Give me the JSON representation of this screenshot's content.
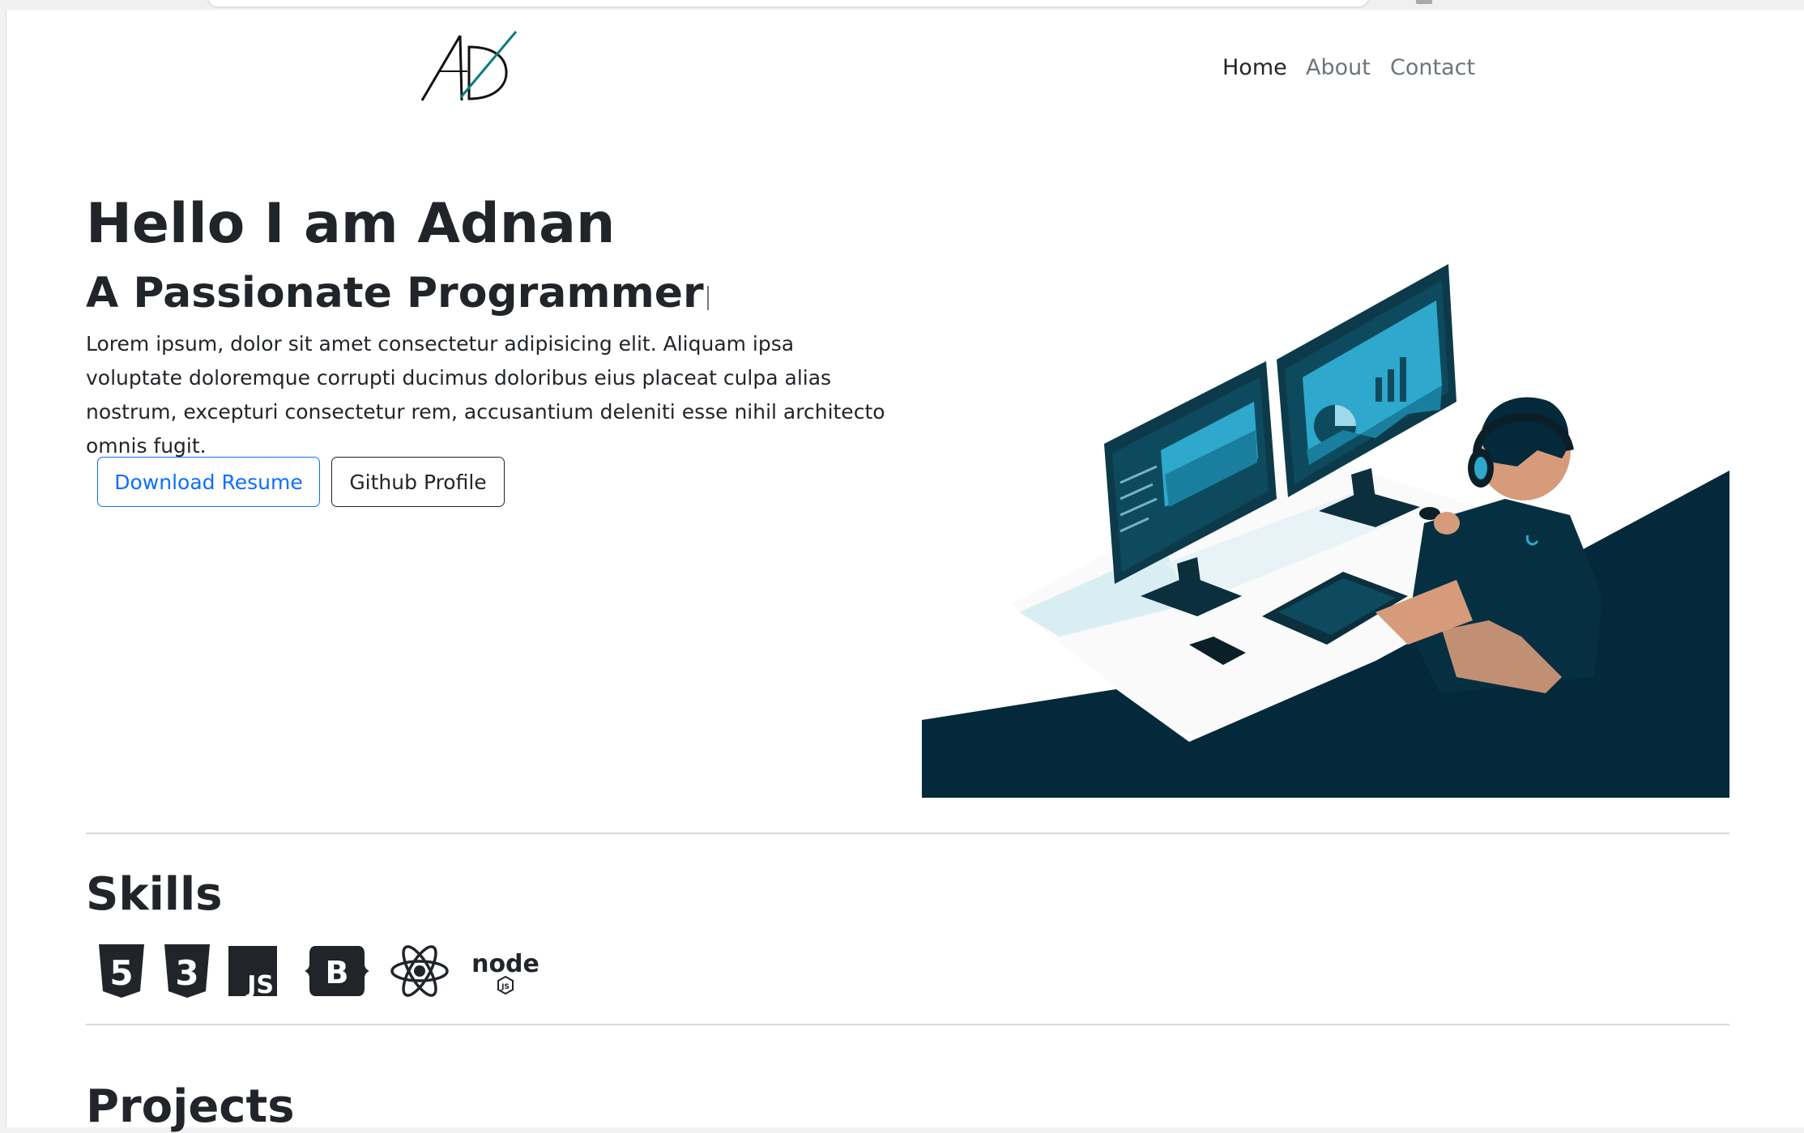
{
  "nav": {
    "logo_text": "AD",
    "links": [
      "Home",
      "About",
      "Contact"
    ],
    "active": "Home"
  },
  "hero": {
    "title": "Hello I am Adnan",
    "subtitle": "A Passionate Programmer",
    "description": "Lorem ipsum, dolor sit amet consectetur adipisicing elit. Aliquam ipsa voluptate doloremque corrupti ducimus doloribus eius placeat culpa alias nostrum, excepturi consectetur rem, accusantium deleniti esse nihil architecto omnis fugit.",
    "buttons": {
      "resume": "Download Resume",
      "github": "Github Profile"
    },
    "illustration": "developer-at-desk-illustration"
  },
  "skills": {
    "title": "Skills",
    "icons": [
      "html5-icon",
      "css3-icon",
      "javascript-icon",
      "bootstrap-icon",
      "react-icon",
      "nodejs-icon"
    ]
  },
  "projects": {
    "title": "Projects"
  },
  "colors": {
    "accent": "#0d6efd",
    "dark": "#212529",
    "muted": "#6c757d",
    "illustration_navy": "#04293a",
    "logo_teal": "#0a7c80"
  }
}
